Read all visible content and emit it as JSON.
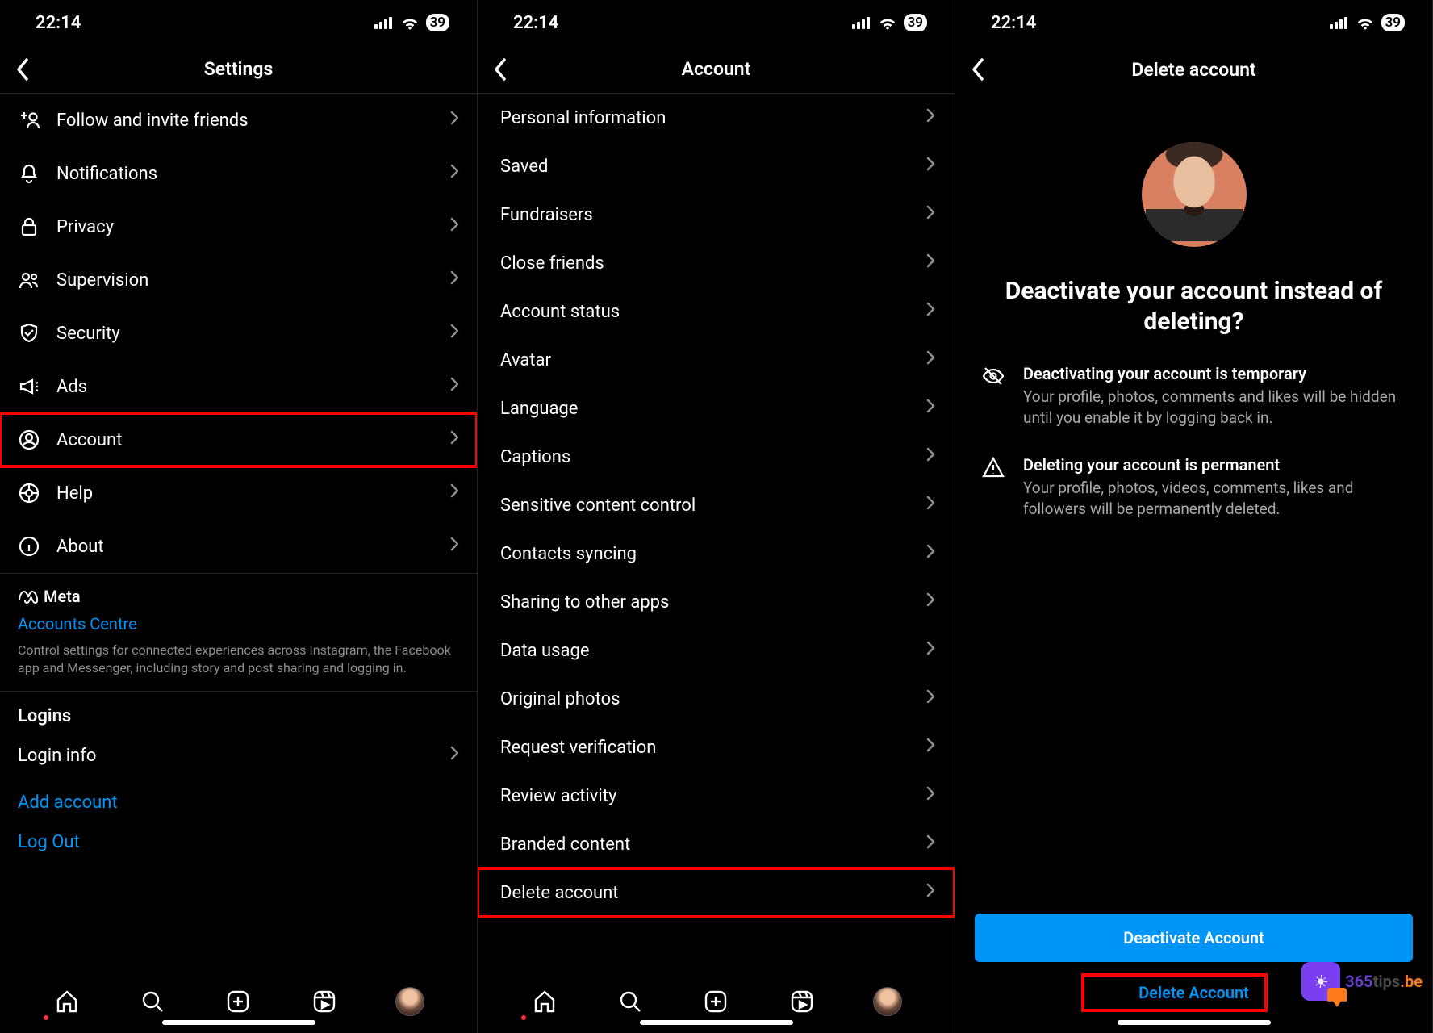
{
  "status": {
    "time": "22:14",
    "battery": "39"
  },
  "screen1": {
    "title": "Settings",
    "items": [
      {
        "label": "Follow and invite friends",
        "icon": "adduser"
      },
      {
        "label": "Notifications",
        "icon": "bell"
      },
      {
        "label": "Privacy",
        "icon": "lock"
      },
      {
        "label": "Supervision",
        "icon": "people"
      },
      {
        "label": "Security",
        "icon": "shield"
      },
      {
        "label": "Ads",
        "icon": "megaphone"
      },
      {
        "label": "Account",
        "icon": "account",
        "highlight": true
      },
      {
        "label": "Help",
        "icon": "help"
      },
      {
        "label": "About",
        "icon": "info"
      }
    ],
    "meta_brand": "Meta",
    "accounts_centre": "Accounts Centre",
    "meta_desc": "Control settings for connected experiences across Instagram, the Facebook app and Messenger, including story and post sharing and logging in.",
    "logins_header": "Logins",
    "login_info": "Login info",
    "add_account": "Add account",
    "log_out": "Log Out"
  },
  "screen2": {
    "title": "Account",
    "items": [
      "Personal information",
      "Saved",
      "Fundraisers",
      "Close friends",
      "Account status",
      "Avatar",
      "Language",
      "Captions",
      "Sensitive content control",
      "Contacts syncing",
      "Sharing to other apps",
      "Data usage",
      "Original photos",
      "Request verification",
      "Review activity",
      "Branded content",
      "Delete account"
    ],
    "highlight_index": 16
  },
  "screen3": {
    "title": "Delete account",
    "heading": "Deactivate your account instead of deleting?",
    "info1_title": "Deactivating your account is temporary",
    "info1_desc": "Your profile, photos, comments and likes will be hidden until you enable it by logging back in.",
    "info2_title": "Deleting your account is permanent",
    "info2_desc": "Your profile, photos, videos, comments, likes and followers will be permanently deleted.",
    "btn_deactivate": "Deactivate Account",
    "btn_delete": "Delete Account"
  },
  "watermark": {
    "p1": "365",
    "p2": "tips",
    "p3": ".be"
  }
}
